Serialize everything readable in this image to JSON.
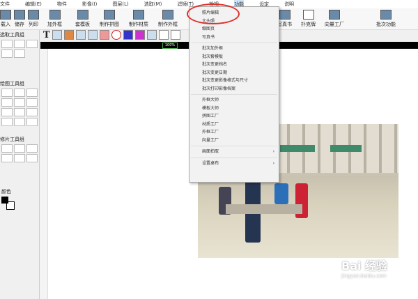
{
  "menubar": [
    "文件",
    "编辑(E)",
    "物件",
    "影像(I)",
    "图层(L)",
    "选取(M)",
    "滤镜(T)",
    "检视",
    "功能",
    "设定",
    "说明"
  ],
  "toolbar": [
    "载入",
    "储存",
    "列印",
    "加外框",
    "套模板",
    "制作拼图",
    "制作材质",
    "制作外框",
    "写真书",
    "扑克牌",
    "向量工厂",
    "批次功能"
  ],
  "left_panel": {
    "select_group": "选取工具组",
    "draw_group": "绘图工具组",
    "retouch_group": "修片工具组",
    "color": "颜色"
  },
  "zoom_level": "100%",
  "function_menu": {
    "group1": [
      "照片编辑",
      "大头照",
      "缩图页",
      "写真书"
    ],
    "group2": [
      "批次加外框",
      "批次套模板",
      "批次变更档名",
      "批次变更日期",
      "批次变更影像格式与尺寸",
      "批次打印影像档案"
    ],
    "group3": [
      "外框大师",
      "模板大师",
      "拼图工厂",
      "材质工厂",
      "外框工厂",
      "向量工厂"
    ],
    "group4": [
      "画面拍取"
    ],
    "group5": [
      "设置桌布"
    ]
  },
  "watermark": {
    "brand": "Bai 经验",
    "url": "jingyan.baidu.com"
  }
}
